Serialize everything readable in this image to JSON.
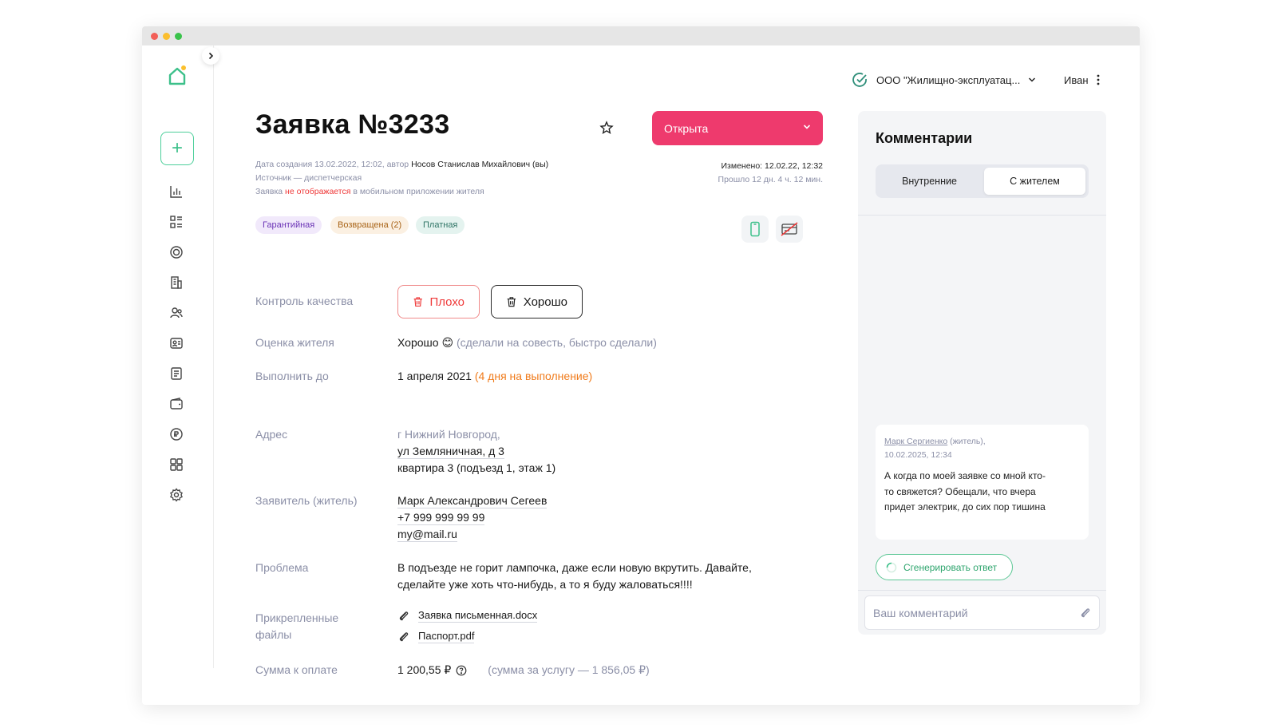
{
  "header": {
    "org_name": "ООО \"Жилищно-эксплуатац...",
    "user_name": "Иван"
  },
  "ticket": {
    "title": "Заявка №3233",
    "status": "Открыта",
    "created_prefix": "Дата создания 13.02.2022, 12:02, автор",
    "created_author": "Носов Станислав Михайлович (вы)",
    "source": "Источник — диспетчерская",
    "visibility_pre": "Заявка",
    "visibility_red": "не отображается",
    "visibility_post": "в мобильном приложении жителя",
    "changed": "Изменено: 12.02.22, 12:32",
    "elapsed": "Прошло 12 дн. 4 ч. 12 мин.",
    "tags": [
      "Гарантийная",
      "Возвращена (2)",
      "Платная"
    ]
  },
  "fields": {
    "quality_label": "Контроль качества",
    "quality_bad": "Плохо",
    "quality_good": "Хорошо",
    "rating_label": "Оценка жителя",
    "rating_value": "Хорошо",
    "rating_emoji": "😊",
    "rating_comment": "(сделали на совесть, быстро сделали)",
    "deadline_label": "Выполнить до",
    "deadline_value": "1 апреля 2021",
    "deadline_note": "(4 дня на выполнение)",
    "address_label": "Адрес",
    "address_city": "г Нижний Новгород,",
    "address_street": "ул Земляничная, д 3",
    "address_apt": "квартира 3 (подъезд 1, этаж 1)",
    "applicant_label": "Заявитель (житель)",
    "applicant_name": "Марк Александрович Сегеев",
    "applicant_phone": "+7 999 999 99 99",
    "applicant_email": "my@mail.ru",
    "problem_label": "Проблема",
    "problem_line1": "В подъезде не горит лампочка, даже если новую вкрутить. Давайте,",
    "problem_line2": "сделайте уже хоть что-нибудь, а то я буду жаловаться!!!!",
    "files_label_1": "Прикрепленные",
    "files_label_2": "файлы",
    "files": [
      "Заявка письменная.docx",
      "Паспорт.pdf"
    ],
    "sum_label": "Сумма к оплате",
    "sum_value": "1 200,55 ₽",
    "sum_note": "(сумма за услугу — 1 856,05 ₽)"
  },
  "comments": {
    "title": "Комментарии",
    "tab_internal": "Внутренние",
    "tab_resident": "С жителем",
    "message": {
      "author": "Марк Сергиенко",
      "role": "(житель),",
      "date": "10.02.2025, 12:34",
      "text": "А когда по моей заявке со мной кто-то свяжется? Обещали, что вчера придет электрик, до сих пор тишина"
    },
    "generate_label": "Сгенерировать ответ",
    "input_placeholder": "Ваш комментарий"
  },
  "colors": {
    "accent_status": "#ee3a6d",
    "brand_green": "#3cc08a",
    "warning_orange": "#f07b1b"
  }
}
